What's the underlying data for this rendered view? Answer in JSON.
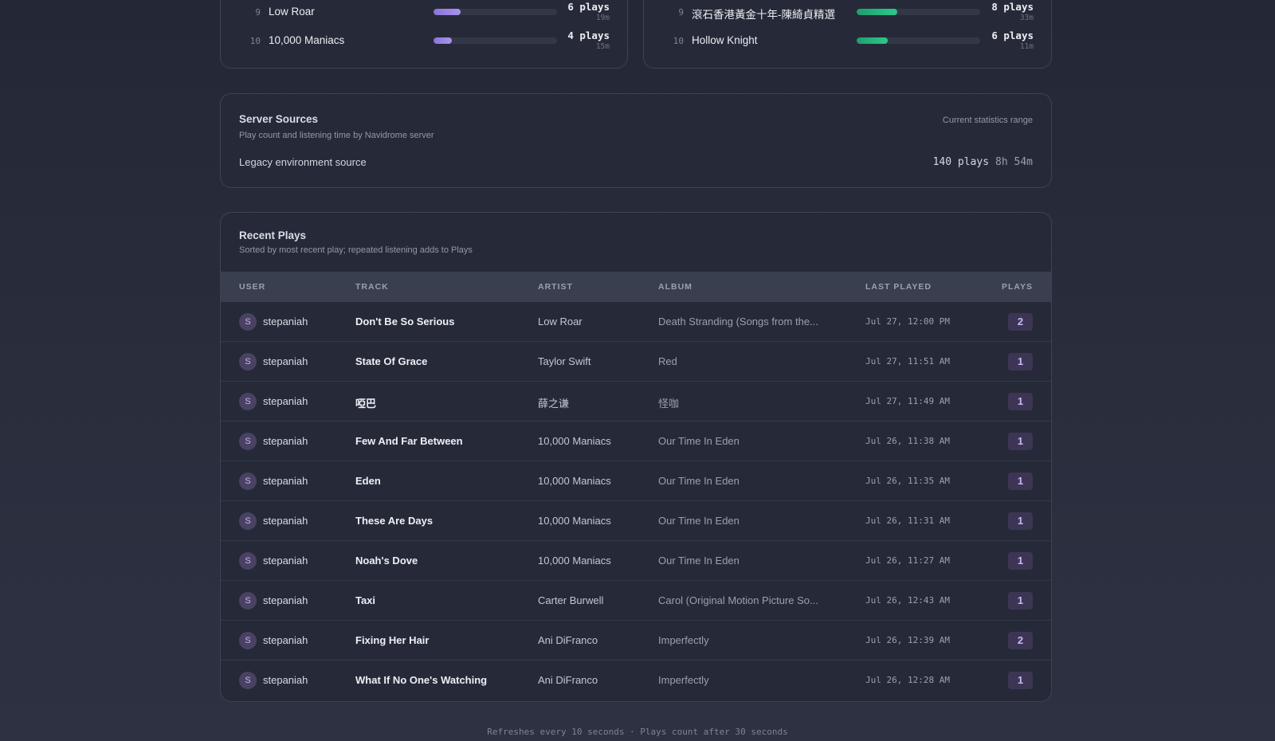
{
  "top_lists": {
    "left": {
      "fill_color": "#9c86e8",
      "items": [
        {
          "rank": "9",
          "name": "Low Roar",
          "plays": "6 plays",
          "time": "19m",
          "fraction": 0.22
        },
        {
          "rank": "10",
          "name": "10,000 Maniacs",
          "plays": "4 plays",
          "time": "15m",
          "fraction": 0.15
        }
      ]
    },
    "right": {
      "fill_color": "#24b37c",
      "items": [
        {
          "rank": "9",
          "name": "滾石香港黃金十年-陳綺貞精選",
          "plays": "8 plays",
          "time": "33m",
          "fraction": 0.33
        },
        {
          "rank": "10",
          "name": "Hollow Knight",
          "plays": "6 plays",
          "time": "11m",
          "fraction": 0.25
        }
      ]
    }
  },
  "server_sources": {
    "title": "Server Sources",
    "subtitle": "Play count and listening time by Navidrome server",
    "range_label": "Current statistics range",
    "source": {
      "name": "Legacy environment source",
      "plays": "140 plays",
      "time": "8h 54m"
    }
  },
  "recent_plays": {
    "title": "Recent Plays",
    "subtitle": "Sorted by most recent play; repeated listening adds to Plays",
    "columns": {
      "user": "USER",
      "track": "TRACK",
      "artist": "ARTIST",
      "album": "ALBUM",
      "last_played": "LAST PLAYED",
      "plays": "PLAYS"
    },
    "rows": [
      {
        "avatar": "S",
        "user": "stepaniah",
        "track": "Don't Be So Serious",
        "artist": "Low Roar",
        "album": "Death Stranding (Songs from the...",
        "last_played": "Jul 27, 12:00 PM",
        "plays": "2"
      },
      {
        "avatar": "S",
        "user": "stepaniah",
        "track": "State Of Grace",
        "artist": "Taylor Swift",
        "album": "Red",
        "last_played": "Jul 27, 11:51 AM",
        "plays": "1"
      },
      {
        "avatar": "S",
        "user": "stepaniah",
        "track": "啞巴",
        "artist": "薛之谦",
        "album": "怪咖",
        "last_played": "Jul 27, 11:49 AM",
        "plays": "1"
      },
      {
        "avatar": "S",
        "user": "stepaniah",
        "track": "Few And Far Between",
        "artist": "10,000 Maniacs",
        "album": "Our Time In Eden",
        "last_played": "Jul 26, 11:38 AM",
        "plays": "1"
      },
      {
        "avatar": "S",
        "user": "stepaniah",
        "track": "Eden",
        "artist": "10,000 Maniacs",
        "album": "Our Time In Eden",
        "last_played": "Jul 26, 11:35 AM",
        "plays": "1"
      },
      {
        "avatar": "S",
        "user": "stepaniah",
        "track": "These Are Days",
        "artist": "10,000 Maniacs",
        "album": "Our Time In Eden",
        "last_played": "Jul 26, 11:31 AM",
        "plays": "1"
      },
      {
        "avatar": "S",
        "user": "stepaniah",
        "track": "Noah's Dove",
        "artist": "10,000 Maniacs",
        "album": "Our Time In Eden",
        "last_played": "Jul 26, 11:27 AM",
        "plays": "1"
      },
      {
        "avatar": "S",
        "user": "stepaniah",
        "track": "Taxi",
        "artist": "Carter Burwell",
        "album": "Carol (Original Motion Picture So...",
        "last_played": "Jul 26, 12:43 AM",
        "plays": "1"
      },
      {
        "avatar": "S",
        "user": "stepaniah",
        "track": "Fixing Her Hair",
        "artist": "Ani DiFranco",
        "album": "Imperfectly",
        "last_played": "Jul 26, 12:39 AM",
        "plays": "2"
      },
      {
        "avatar": "S",
        "user": "stepaniah",
        "track": "What If No One's Watching",
        "artist": "Ani DiFranco",
        "album": "Imperfectly",
        "last_played": "Jul 26, 12:28 AM",
        "plays": "1"
      }
    ]
  },
  "footer": {
    "text": "Refreshes every 10 seconds · Plays count after 30 seconds"
  }
}
